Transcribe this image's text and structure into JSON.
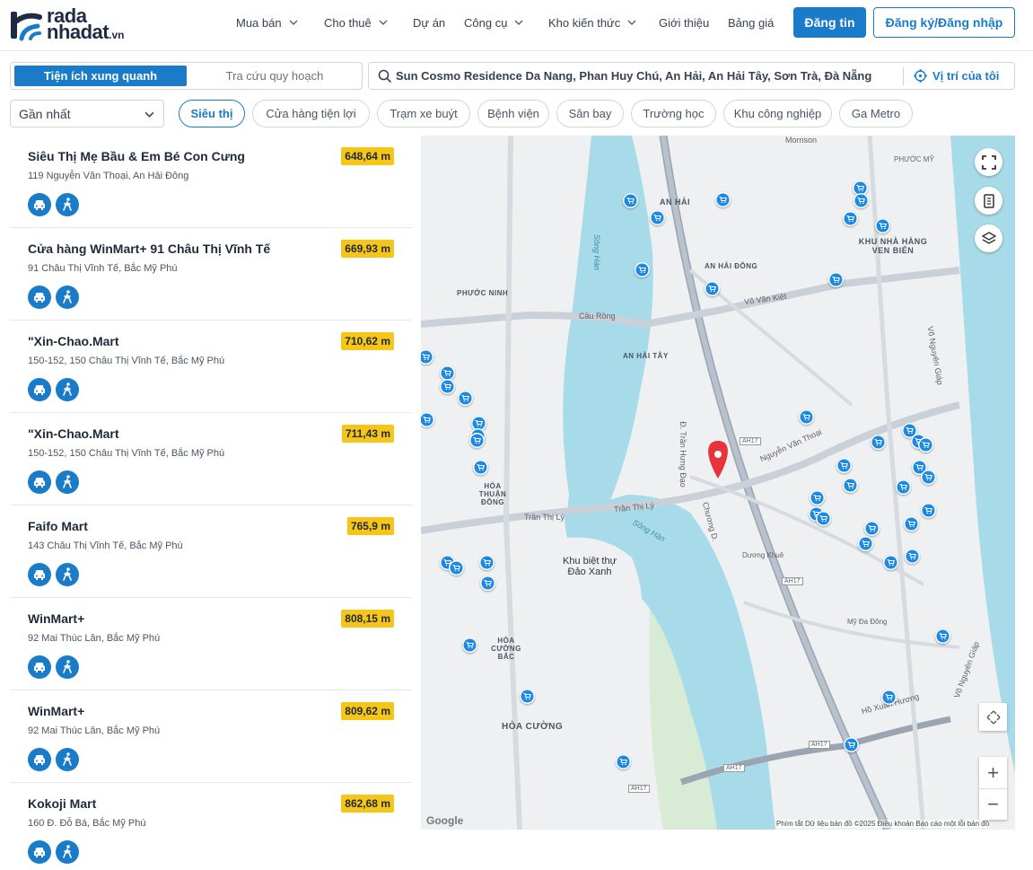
{
  "brand": {
    "line1": "rada",
    "line2": "nhadat",
    "tld": ".vn"
  },
  "nav": [
    {
      "label": "Mua bán",
      "dropdown": true
    },
    {
      "label": "Cho thuê",
      "dropdown": true
    },
    {
      "label": "Dự án",
      "dropdown": false
    },
    {
      "label": "Công cụ",
      "dropdown": true
    },
    {
      "label": "Kho kiến thức",
      "dropdown": true
    },
    {
      "label": "Giới thiệu",
      "dropdown": false
    },
    {
      "label": "Bảng giá",
      "dropdown": false
    }
  ],
  "header": {
    "post_label": "Đăng tin",
    "login_label": "Đăng ký/Đăng nhập"
  },
  "search": {
    "tab_active": "Tiện ích xung quanh",
    "tab_inactive": "Tra cứu quy hoạch",
    "query": "Sun Cosmo Residence Da Nang, Phan Huy Chú, An Hải, An Hải Tây, Sơn Trà, Đà Nẵng",
    "locate_label": "Vị trí của tôi"
  },
  "filters": {
    "sort": "Gần nhất",
    "chips": [
      "Siêu thị",
      "Cửa hàng tiện lợi",
      "Trạm xe buýt",
      "Bệnh viện",
      "Sân bay",
      "Trường học",
      "Khu công nghiệp",
      "Ga Metro"
    ],
    "active_chip": "Siêu thị"
  },
  "places": [
    {
      "name": "Siêu Thị Mẹ Bầu & Em Bé Con Cưng",
      "address": "119 Nguyễn Văn Thoại, An Hải Đông",
      "distance": "648,64 m"
    },
    {
      "name": "Cửa hàng WinMart+ 91 Châu Thị Vĩnh Tế",
      "address": "91 Châu Thị Vĩnh Tế, Bắc Mỹ Phú",
      "distance": "669,93 m"
    },
    {
      "name": "\"Xin-Chao.Mart",
      "address": "150-152, 150 Châu Thị Vĩnh Tế, Bắc Mỹ Phú",
      "distance": "710,62 m"
    },
    {
      "name": "\"Xin-Chao.Mart",
      "address": "150-152, 150 Châu Thị Vĩnh Tế, Bắc Mỹ Phú",
      "distance": "711,43 m"
    },
    {
      "name": "Faifo Mart",
      "address": "143 Châu Thị Vĩnh Tế, Bắc Mỹ Phú",
      "distance": "765,9 m"
    },
    {
      "name": "WinMart+",
      "address": "92 Mai Thúc Lân, Bắc Mỹ Phú",
      "distance": "808,15 m"
    },
    {
      "name": "WinMart+",
      "address": "92 Mai Thúc Lân, Bắc Mỹ Phú",
      "distance": "809,62 m"
    },
    {
      "name": "Kokoji Mart",
      "address": "160 Đ. Đỗ Bá, Bắc Mỹ Phú",
      "distance": "862,68 m"
    }
  ],
  "map": {
    "labels": {
      "an_hai": "AN HẢI",
      "an_hai_dong": "AN HẢI ĐÔNG",
      "an_hai_tay": "AN HẢI TÂY",
      "phuoc_ninh": "PHƯỚC NINH",
      "hoa_thuan_dong": "HÒA THUẬN ĐÔNG",
      "hoa_cuong_bac": "HÒA CƯỜNG BẮC",
      "hoa_cuong": "HÒA CƯỜNG",
      "khu_nha_hang": "KHU NHÀ HÀNG VEN BIỂN",
      "phuoc_my": "PHƯỚC MỸ",
      "song_han": "Sông Hàn",
      "cau_rong": "Cầu Rồng",
      "tran_thi_ly": "Trần Thị Lý",
      "vo_van_kiet": "Võ Văn Kiệt",
      "dao_xanh": "Khu biệt thự Đảo Xanh",
      "ho_xuan_huong": "Hồ Xuân Hương",
      "my_da_dong": "Mỹ Đa Đông",
      "tran_hung_dao": "Đ. Trần Hưng Đạo",
      "chuong_duong": "Chương D.",
      "nguyen_van_thoai": "Nguyễn Văn Thoại",
      "duong_khue": "Dương Khuê",
      "vo_nguyen_giap": "Võ Nguyên Giáp",
      "ah17": "AH17",
      "mornson": "Mornson"
    },
    "attribution": "Phím tắt   Dữ liệu bản đồ ©2025   Điều khoản   Báo cáo một lỗi bản đồ",
    "google": "Google"
  }
}
